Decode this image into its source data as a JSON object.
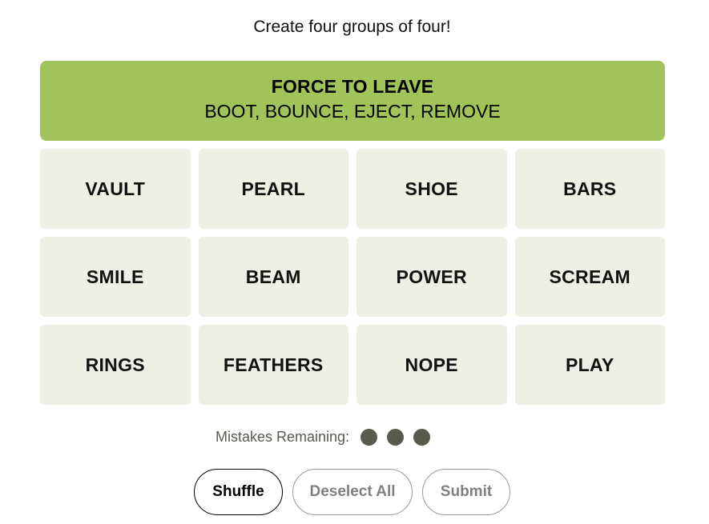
{
  "instructions": "Create four groups of four!",
  "solved_groups": [
    {
      "title": "FORCE TO LEAVE",
      "members": "BOOT, BOUNCE, EJECT, REMOVE",
      "color": "#a0c35a"
    }
  ],
  "tiles": [
    {
      "label": "VAULT"
    },
    {
      "label": "PEARL"
    },
    {
      "label": "SHOE"
    },
    {
      "label": "BARS"
    },
    {
      "label": "SMILE"
    },
    {
      "label": "BEAM"
    },
    {
      "label": "POWER"
    },
    {
      "label": "SCREAM"
    },
    {
      "label": "RINGS"
    },
    {
      "label": "FEATHERS"
    },
    {
      "label": "NOPE"
    },
    {
      "label": "PLAY"
    }
  ],
  "mistakes": {
    "label": "Mistakes Remaining:",
    "remaining": 3
  },
  "buttons": {
    "shuffle": "Shuffle",
    "deselect_all": "Deselect All",
    "submit": "Submit"
  },
  "colors": {
    "tile_bg": "#efefe6",
    "dot": "#5a594e",
    "solved_green": "#a0c35a"
  }
}
